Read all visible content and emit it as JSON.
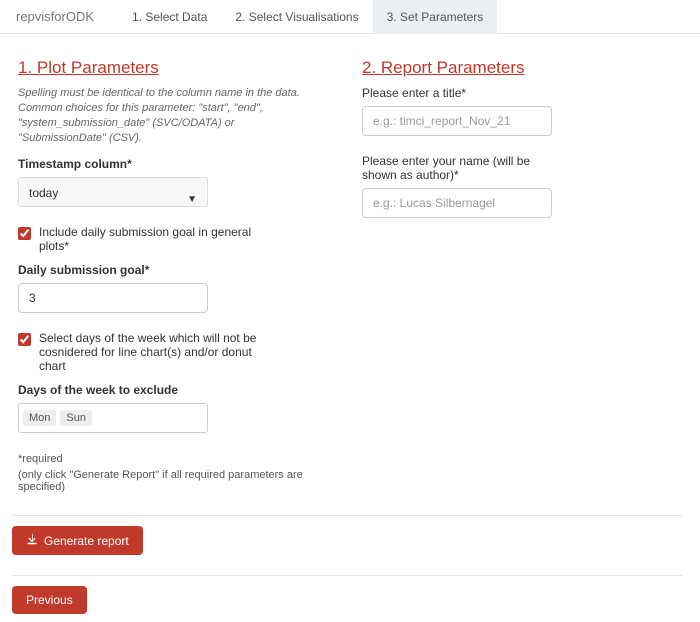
{
  "brand": "repvisforODK",
  "tabs": {
    "t1": "1. Select Data",
    "t2": "2. Select Visualisations",
    "t3": "3. Set Parameters"
  },
  "plot": {
    "heading": "1. Plot Parameters",
    "help": "Spelling must be identical to the column name in the data. Common choices for this parameter: \"start\", \"end\", \"system_submission_date\" (SVC/ODATA) or \"SubmissionDate\" (CSV).",
    "timestamp_label": "Timestamp column*",
    "timestamp_value": "today",
    "include_goal_label": "Include daily submission goal in general plots*",
    "daily_goal_label": "Daily submission goal*",
    "daily_goal_value": "3",
    "exclude_days_label": "Select days of the week which will not be cosnidered for line chart(s) and/or donut chart",
    "days_exclude_label": "Days of the week to exclude",
    "chip1": "Mon",
    "chip2": "Sun",
    "footnote_req": "*required",
    "footnote_note": "(only click \"Generate Report\" if all required parameters are specified)"
  },
  "report": {
    "heading": "2. Report Parameters",
    "title_label": "Please enter a title*",
    "title_placeholder": "e.g.: timci_report_Nov_21",
    "author_label": "Please enter your name (will be shown as author)*",
    "author_placeholder": "e.g.: Lucas Silbernagel"
  },
  "buttons": {
    "generate": "Generate report",
    "previous": "Previous"
  }
}
